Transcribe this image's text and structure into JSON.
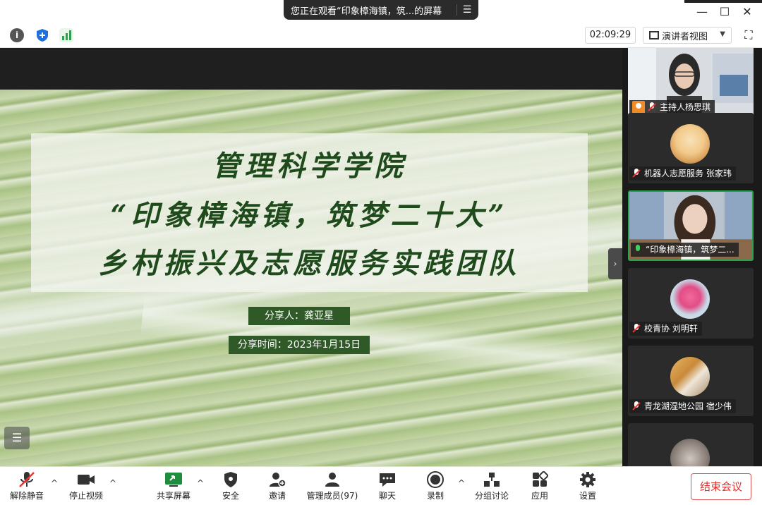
{
  "share_banner": {
    "text": "您正在观看“印象樟海镇，筑...的屏幕"
  },
  "window": {
    "minimize": "—",
    "maximize": "☐",
    "close": "✕"
  },
  "toolbar": {
    "timer": "02:09:29",
    "view_mode": "演讲者视图",
    "info_glyph": "i"
  },
  "slide": {
    "title_line1": "管理科学学院",
    "title_line2": "“印象樟海镇，筑梦二十大”",
    "title_line3": "乡村振兴及志愿服务实践团队",
    "sharer": "分享人：龚亚星",
    "share_time": "分享时间：2023年1月15日",
    "title_color": "#1f4a1c",
    "label_bg": "#2f5a27"
  },
  "participants": [
    {
      "name": "主持人杨思琪",
      "mic": "muted",
      "host": true,
      "avatar": "camera-woman-glasses"
    },
    {
      "name": "机器人志愿服务 张家玮",
      "mic": "muted",
      "host": false,
      "avatar": "cartoon-avatar"
    },
    {
      "name": "“印象樟海镇，筑梦二...",
      "mic": "live",
      "host": false,
      "avatar": "camera-woman",
      "active": true
    },
    {
      "name": "校青协 刘明轩",
      "mic": "muted",
      "host": false,
      "avatar": "flower-avatar"
    },
    {
      "name": "青龙湖湿地公园  宿少伟",
      "mic": "muted",
      "host": false,
      "avatar": "photo-avatar"
    },
    {
      "name": "",
      "mic": "muted",
      "host": false,
      "avatar": "partial-avatar"
    }
  ],
  "controls": {
    "unmute": "解除静音",
    "stop_video": "停止视频",
    "share_screen": "共享屏幕",
    "security": "安全",
    "invite": "邀请",
    "manage_members": "管理成员(97)",
    "chat": "聊天",
    "record": "录制",
    "breakout": "分组讨论",
    "apps": "应用",
    "settings": "设置",
    "end_meeting": "结束会议"
  },
  "colors": {
    "accent_green": "#2aa14a",
    "end_red": "#e0322f"
  }
}
